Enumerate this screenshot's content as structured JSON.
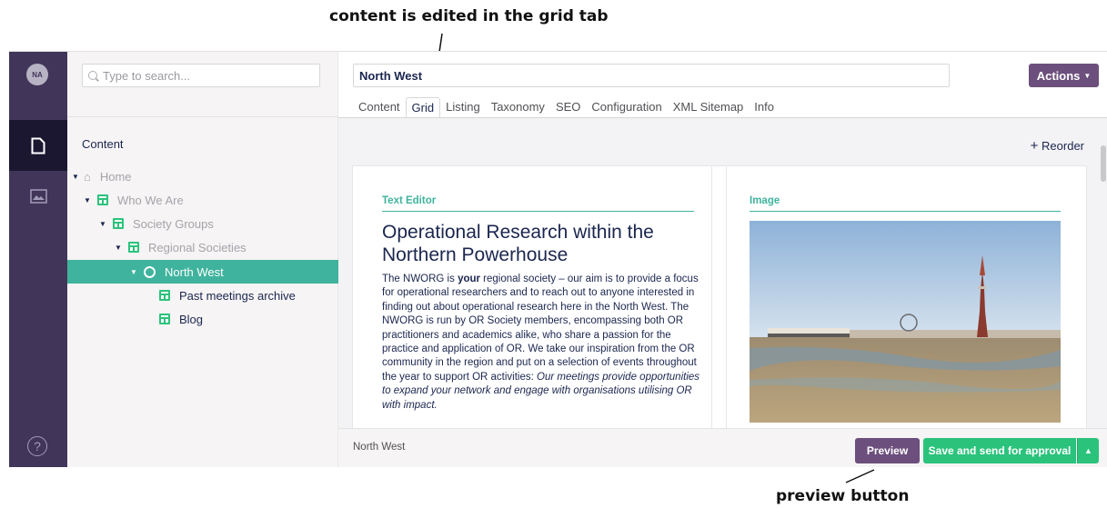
{
  "annotations": {
    "top": "content is edited in the grid tab",
    "bottom": "preview button"
  },
  "sidebar": {
    "avatar_initials": "NA",
    "sections": [
      {
        "icon": "document-icon",
        "active": true
      },
      {
        "icon": "image-icon",
        "active": false
      }
    ],
    "help_icon": "help-icon"
  },
  "tree": {
    "search_placeholder": "Type to search...",
    "header": "Content",
    "nodes": [
      {
        "label": "Home",
        "icon": "home-icon",
        "expanded": true
      },
      {
        "label": "Who We Are",
        "icon": "document-icon",
        "expanded": true
      },
      {
        "label": "Society Groups",
        "icon": "document-icon",
        "expanded": true
      },
      {
        "label": "Regional Societies",
        "icon": "document-icon",
        "expanded": true
      },
      {
        "label": "North West",
        "icon": "globe-icon",
        "expanded": true,
        "selected": true
      },
      {
        "label": "Past meetings archive",
        "icon": "document-icon"
      },
      {
        "label": "Blog",
        "icon": "document-icon"
      }
    ]
  },
  "editor": {
    "name": "North West",
    "actions_label": "Actions",
    "tabs": [
      "Content",
      "Grid",
      "Listing",
      "Taxonomy",
      "SEO",
      "Configuration",
      "XML Sitemap",
      "Info"
    ],
    "active_tab": "Grid",
    "reorder_label": "Reorder",
    "text_cell": {
      "label": "Text Editor",
      "heading": "Operational Research within the Northern Powerhouse",
      "body_1": "The NWORG is ",
      "body_bold": "your",
      "body_2": " regional society – our aim is to provide a focus for operational researchers and to reach out to anyone interested in finding out about operational research here in the North West. The NWORG is run by OR Society members, encompassing both OR practitioners and academics alike, who share a passion for the practice and application of OR. We take our inspiration from the OR community in the region and put on a selection of events throughout the year to support OR activities: ",
      "body_italic": "Our meetings provide opportunities to expand your network and engage with organisations utilising OR with impact."
    },
    "image_cell": {
      "label": "Image"
    }
  },
  "footer": {
    "breadcrumb": "North West",
    "preview_label": "Preview",
    "save_label": "Save and send for approval"
  },
  "colors": {
    "sidebar": "#413659",
    "accent_green": "#2bc37c",
    "teal": "#3fb39d",
    "purple_button": "#6c4f7c"
  }
}
